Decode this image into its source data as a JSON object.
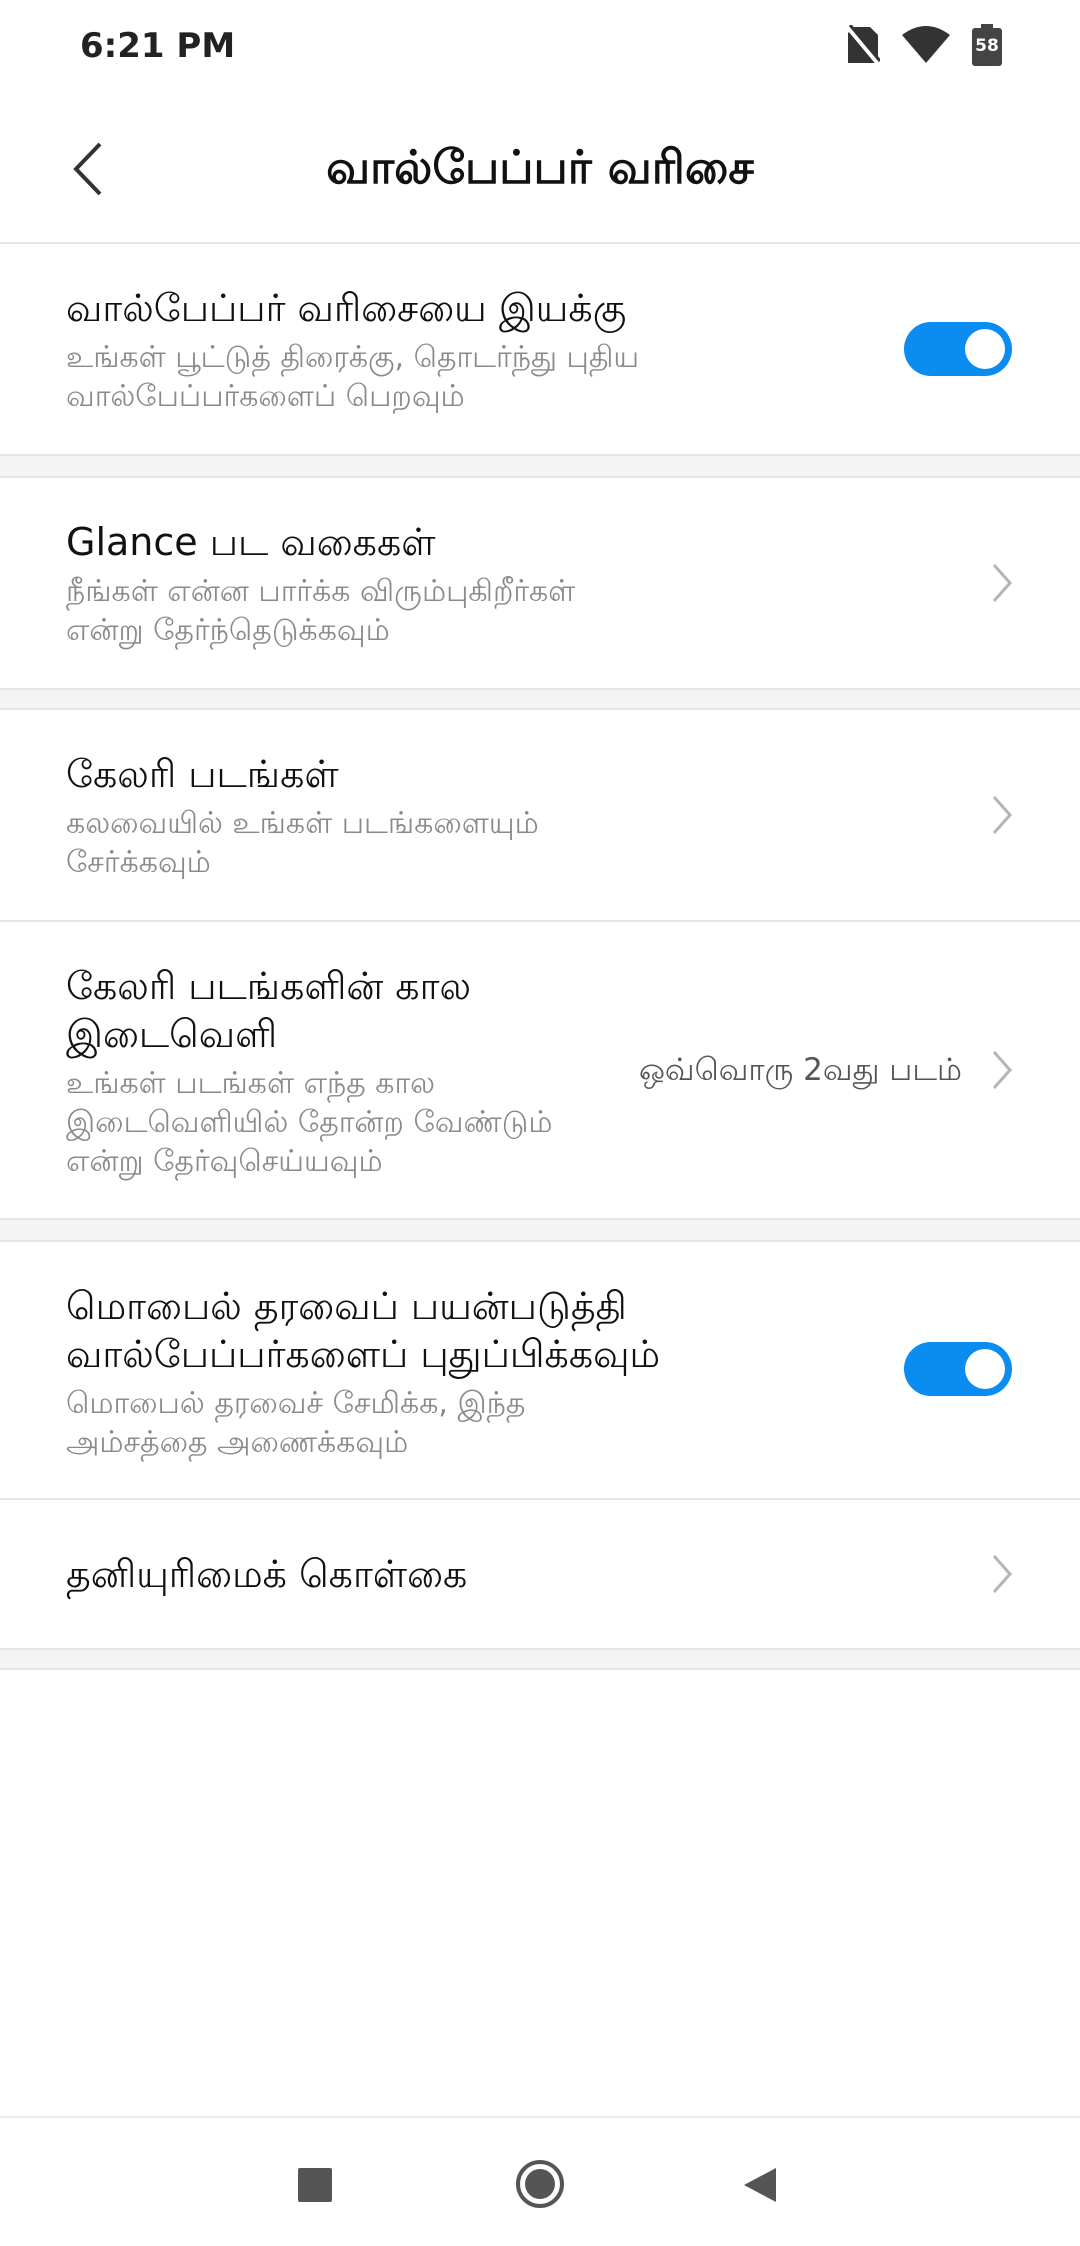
{
  "status_bar": {
    "time": "6:21 PM",
    "battery_level": "58",
    "icons": [
      "no-sim-icon",
      "wifi-icon",
      "battery-icon"
    ]
  },
  "header": {
    "title": "வால்பேப்பர் வரிசை",
    "back_icon": "chevron-left-icon"
  },
  "settings": {
    "enable_carousel": {
      "title": "வால்பேப்பர் வரிசையை இயக்கு",
      "subtitle_line1": "உங்கள் பூட்டுத் திரைக்கு, தொடர்ந்து புதிய",
      "subtitle_line2": "வால்பேப்பர்களைப் பெறவும்",
      "enabled": true
    },
    "glance_categories": {
      "title": "Glance பட வகைகள்",
      "subtitle_line1": "நீங்கள் என்ன பார்க்க விரும்புகிறீர்கள்",
      "subtitle_line2": "என்று தேர்ந்தெடுக்கவும்"
    },
    "gallery_images": {
      "title": "கேலரி படங்கள்",
      "subtitle_line1": "கலவையில் உங்கள் படங்களையும்",
      "subtitle_line2": "சேர்க்கவும்"
    },
    "gallery_interval": {
      "title_line1": "கேலரி படங்களின் கால",
      "title_line2": "இடைவெளி",
      "subtitle_line1": "உங்கள் படங்கள் எந்த கால",
      "subtitle_line2": "இடைவெளியில் தோன்ற வேண்டும்",
      "subtitle_line3": "என்று தேர்வுசெய்யவும்",
      "value": "ஒவ்வொரு 2வது படம்"
    },
    "mobile_data_refresh": {
      "title_line1": "மொபைல் தரவைப் பயன்படுத்தி",
      "title_line2": "வால்பேப்பர்களைப் புதுப்பிக்கவும்",
      "subtitle_line1": "மொபைல் தரவைச் சேமிக்க, இந்த",
      "subtitle_line2": "அம்சத்தை அணைக்கவும்",
      "enabled": true
    },
    "privacy_policy": {
      "title": "தனியுரிமைக் கொள்கை"
    }
  },
  "colors": {
    "accent": "#0a8cf0",
    "subtitle": "#8a8a8a",
    "divider": "#e6e6e6"
  },
  "nav_bar": {
    "icons": [
      "recents-square-icon",
      "home-circle-icon",
      "back-triangle-icon"
    ]
  }
}
